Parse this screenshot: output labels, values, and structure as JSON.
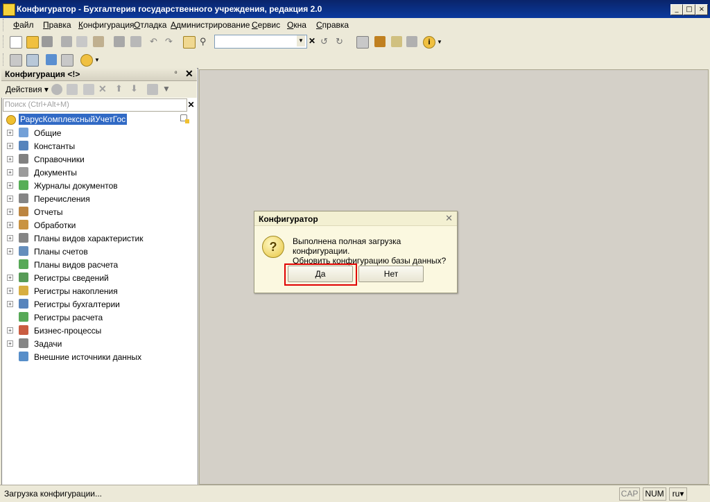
{
  "window": {
    "title": "Конфигуратор - Бухгалтерия государственного учреждения, редакция 2.0"
  },
  "menu": [
    {
      "label": "Файл",
      "hot": "Ф",
      "rest": "айл"
    },
    {
      "label": "Правка",
      "hot": "П",
      "rest": "равка"
    },
    {
      "label": "Конфигурация",
      "hot": "К",
      "rest": "онфигурация"
    },
    {
      "label": "Отладка",
      "hot": "О",
      "rest": "тладка"
    },
    {
      "label": "Администрирование",
      "hot": "А",
      "rest": "дминистрирование"
    },
    {
      "label": "Сервис",
      "hot": "С",
      "rest": "ервис"
    },
    {
      "label": "Окна",
      "hot": "О",
      "rest": "кна"
    },
    {
      "label": "Справка",
      "hot": "С",
      "rest": "правка"
    }
  ],
  "panel": {
    "title": "Конфигурация <!>",
    "pin": "ᵒ",
    "actions_label": "Действия",
    "search_placeholder": "Поиск (Ctrl+Alt+M)",
    "root": "РарусКомплексныйУчетГос",
    "items": [
      {
        "label": "Общие",
        "icon": "common-icon",
        "color": "#5a8fd0",
        "expandable": true
      },
      {
        "label": "Константы",
        "icon": "constants-icon",
        "color": "#3a6fb0",
        "expandable": true
      },
      {
        "label": "Справочники",
        "icon": "catalogs-icon",
        "color": "#6a6a6a",
        "expandable": true
      },
      {
        "label": "Документы",
        "icon": "documents-icon",
        "color": "#8a8a8a",
        "expandable": true
      },
      {
        "label": "Журналы документов",
        "icon": "journals-icon",
        "color": "#3aa03a",
        "expandable": true
      },
      {
        "label": "Перечисления",
        "icon": "enums-icon",
        "color": "#707070",
        "expandable": true
      },
      {
        "label": "Отчеты",
        "icon": "reports-icon",
        "color": "#b07020",
        "expandable": true
      },
      {
        "label": "Обработки",
        "icon": "dataprocessors-icon",
        "color": "#c08020",
        "expandable": true
      },
      {
        "label": "Планы видов характеристик",
        "icon": "chart-of-characteristic-types-icon",
        "color": "#707070",
        "expandable": true
      },
      {
        "label": "Планы счетов",
        "icon": "chart-of-accounts-icon",
        "color": "#4a7ab0",
        "expandable": true
      },
      {
        "label": "Планы видов расчета",
        "icon": "chart-of-calculation-types-icon",
        "color": "#3a9a3a",
        "expandable": false
      },
      {
        "label": "Регистры сведений",
        "icon": "information-registers-icon",
        "color": "#3a8a3a",
        "expandable": true
      },
      {
        "label": "Регистры накопления",
        "icon": "accumulation-registers-icon",
        "color": "#d0a020",
        "expandable": true
      },
      {
        "label": "Регистры бухгалтерии",
        "icon": "accounting-registers-icon",
        "color": "#3a6fb0",
        "expandable": true
      },
      {
        "label": "Регистры расчета",
        "icon": "calculation-registers-icon",
        "color": "#3a9a3a",
        "expandable": false
      },
      {
        "label": "Бизнес-процессы",
        "icon": "business-processes-icon",
        "color": "#c04020",
        "expandable": true
      },
      {
        "label": "Задачи",
        "icon": "tasks-icon",
        "color": "#707070",
        "expandable": true
      },
      {
        "label": "Внешние источники данных",
        "icon": "external-data-sources-icon",
        "color": "#3a7ac0",
        "expandable": false
      }
    ]
  },
  "dialog": {
    "title": "Конфигуратор",
    "message_line1": "Выполнена полная загрузка конфигурации.",
    "message_line2": "Обновить конфигурацию базы данных?",
    "yes_label": "Да",
    "no_label": "Нет"
  },
  "status": {
    "text": "Загрузка конфигурации...",
    "cap": "CAP",
    "num": "NUM",
    "lang": "ru"
  },
  "colors": {
    "highlight": "#e00000",
    "titlebar": "#0a246a"
  }
}
